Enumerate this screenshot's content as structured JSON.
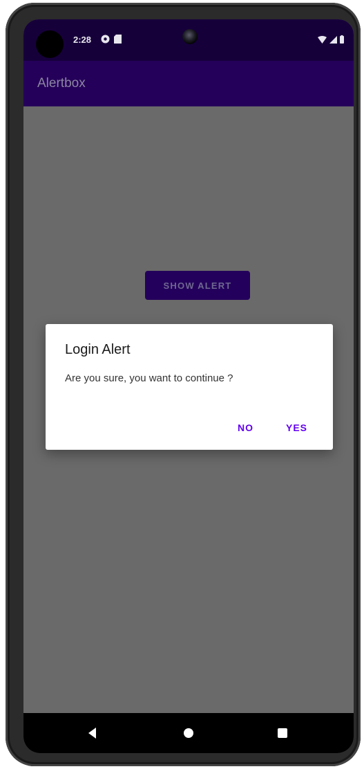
{
  "status_bar": {
    "time": "2:28",
    "icons_left": [
      "settings-icon",
      "sd-card-icon"
    ],
    "icons_right": [
      "wifi-icon",
      "signal-icon",
      "battery-icon"
    ]
  },
  "app_bar": {
    "title": "Alertbox"
  },
  "main": {
    "show_alert_label": "SHOW ALERT"
  },
  "dialog": {
    "title": "Login Alert",
    "message": "Are you sure, you want to continue ?",
    "no_label": "NO",
    "yes_label": "YES"
  },
  "nav_bar": {
    "icons": [
      "back-icon",
      "home-icon",
      "recents-icon"
    ]
  },
  "colors": {
    "status_bar": "#16003a",
    "app_bar": "#25005a",
    "scrim_background": "#6a6a6a",
    "accent": "#6200ee",
    "dialog_background": "#ffffff"
  }
}
